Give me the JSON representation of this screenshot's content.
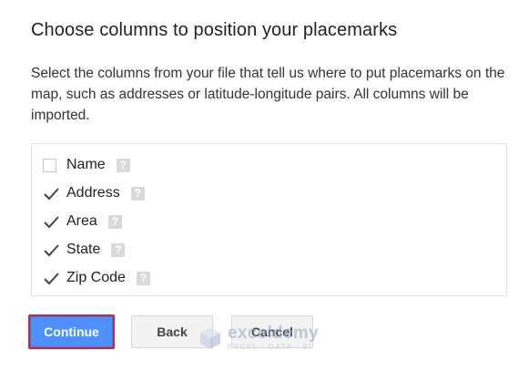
{
  "dialog": {
    "title": "Choose columns to position your placemarks",
    "description": "Select the columns from your file that tell us where to put placemarks on the map, such as addresses or latitude-longitude pairs. All columns will be imported."
  },
  "columns": [
    {
      "label": "Name",
      "checked": false
    },
    {
      "label": "Address",
      "checked": true
    },
    {
      "label": "Area",
      "checked": true
    },
    {
      "label": "State",
      "checked": true
    },
    {
      "label": "Zip Code",
      "checked": true
    }
  ],
  "help_icon_glyph": "?",
  "buttons": {
    "continue_label": "Continue",
    "back_label": "Back",
    "cancel_label": "Cancel"
  },
  "watermark": {
    "name": "exceldemy",
    "tagline": "EXCEL · DATA · BI"
  },
  "colors": {
    "accent": "#4d90fe",
    "focus_outline": "#d9213a"
  }
}
